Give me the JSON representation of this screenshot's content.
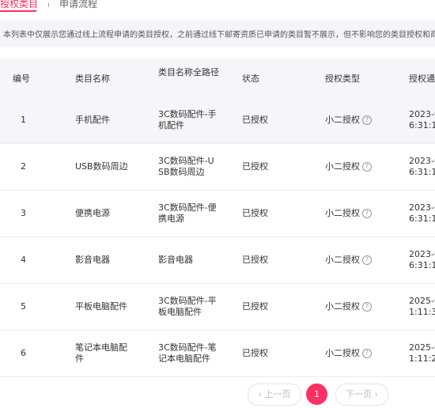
{
  "tabs": {
    "active": "授权类目",
    "next": "申请流程"
  },
  "notice": "本列表中仅展示您通过线上流程申请的类目授权，之前通过线下邮寄资质已申请的类目暂不展示，但不影响您的类目授权和商品发",
  "table": {
    "headers": [
      "编号",
      "类目名称",
      "类目名称全路径",
      "状态",
      "授权类型",
      "授权通"
    ],
    "rows": [
      {
        "no": "1",
        "name": [
          "手机配件"
        ],
        "path": [
          "3C数码配件-手",
          "机配件"
        ],
        "status": "已授权",
        "type": "小二授权",
        "date": [
          "2023-0",
          "6:31:1"
        ]
      },
      {
        "no": "2",
        "name": [
          "USB数码周边"
        ],
        "path": [
          "3C数码配件-U",
          "SB数码周边"
        ],
        "status": "已授权",
        "type": "小二授权",
        "date": [
          "2023-0",
          "6:31:1"
        ]
      },
      {
        "no": "3",
        "name": [
          "便携电源"
        ],
        "path": [
          "3C数码配件-便",
          "携电源"
        ],
        "status": "已授权",
        "type": "小二授权",
        "date": [
          "2023-0",
          "6:31:1"
        ]
      },
      {
        "no": "4",
        "name": [
          "影音电器"
        ],
        "path": [
          "影音电器"
        ],
        "status": "已授权",
        "type": "小二授权",
        "date": [
          "2023-0",
          "6:31:1"
        ]
      },
      {
        "no": "5",
        "name": [
          "平板电脑配件"
        ],
        "path": [
          "3C数码配件-平",
          "板电脑配件"
        ],
        "status": "已授权",
        "type": "小二授权",
        "date": [
          "2025-0",
          "1:11:3"
        ]
      },
      {
        "no": "6",
        "name": [
          "笔记本电脑配",
          "件"
        ],
        "path": [
          "3C数码配件-笔",
          "记本电脑配件"
        ],
        "status": "已授权",
        "type": "小二授权",
        "date": [
          "2025-0",
          "1:11:2"
        ]
      }
    ]
  },
  "pager": {
    "prev": "‹ 上一页",
    "current": "1",
    "next": "下一页 ›"
  },
  "colors": {
    "accent": "#ff2e63",
    "header_bg": "#f5f6fa"
  },
  "icons": {
    "help": "question-circle-icon"
  }
}
